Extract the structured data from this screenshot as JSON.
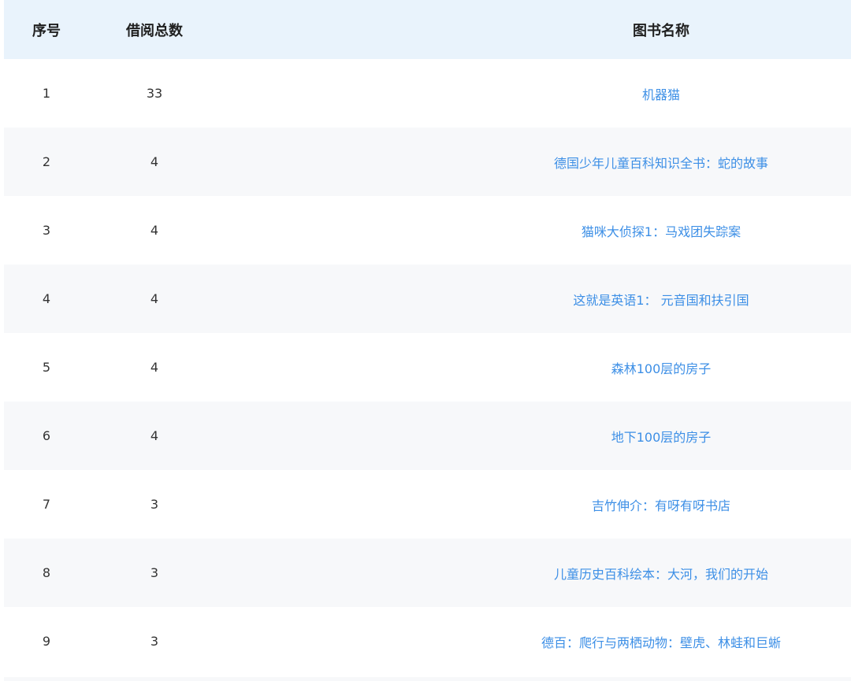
{
  "table": {
    "headers": {
      "index": "序号",
      "count": "借阅总数",
      "title": "图书名称"
    },
    "rows": [
      {
        "index": "1",
        "count": "33",
        "title": "机器猫"
      },
      {
        "index": "2",
        "count": "4",
        "title": "德国少年儿童百科知识全书：蛇的故事"
      },
      {
        "index": "3",
        "count": "4",
        "title": "猫咪大侦探1：马戏团失踪案"
      },
      {
        "index": "4",
        "count": "4",
        "title": "这就是英语1： 元音国和扶引国"
      },
      {
        "index": "5",
        "count": "4",
        "title": "森林100层的房子"
      },
      {
        "index": "6",
        "count": "4",
        "title": "地下100层的房子"
      },
      {
        "index": "7",
        "count": "3",
        "title": "吉竹伸介：有呀有呀书店"
      },
      {
        "index": "8",
        "count": "3",
        "title": "儿童历史百科绘本：大河，我们的开始"
      },
      {
        "index": "9",
        "count": "3",
        "title": "德百：爬行与两栖动物：壁虎、林蛙和巨蜥"
      }
    ]
  },
  "colors": {
    "header_bg": "#e9f3fc",
    "stripe_bg": "#f7f8fa",
    "link": "#3d8fe6",
    "text": "#333333"
  }
}
